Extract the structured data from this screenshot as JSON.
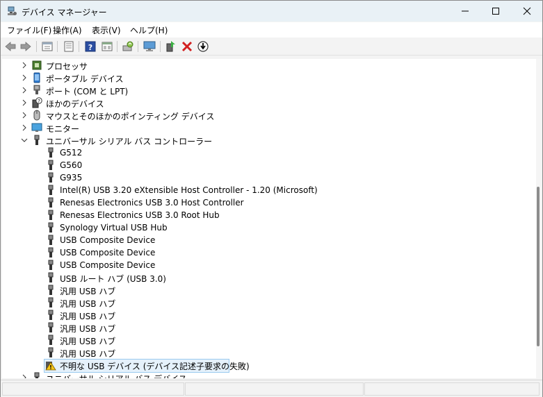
{
  "window": {
    "title": "デバイス マネージャー"
  },
  "menu": [
    "ファイル(F)",
    "操作(A)",
    "表示(V)",
    "ヘルプ(H)"
  ],
  "toolbar": {
    "buttons": [
      "back-icon",
      "forward-icon",
      "properties-view-icon",
      "list-view-icon",
      "help-icon",
      "grid-view-icon",
      "update-driver-icon",
      "monitor-scan-icon",
      "enable-device-icon",
      "uninstall-icon",
      "download-icon"
    ]
  },
  "tree": {
    "categories_top": [
      {
        "label": "プロセッサ",
        "icon": "processor-icon"
      },
      {
        "label": "ポータブル デバイス",
        "icon": "portable-device-icon"
      },
      {
        "label": "ポート (COM と LPT)",
        "icon": "port-icon"
      },
      {
        "label": "ほかのデバイス",
        "icon": "other-device-icon"
      },
      {
        "label": "マウスとそのほかのポインティング デバイス",
        "icon": "mouse-icon"
      },
      {
        "label": "モニター",
        "icon": "monitor-icon"
      }
    ],
    "usb_category": {
      "label": "ユニバーサル シリアル バス コントローラー",
      "icon": "usb-icon",
      "expanded": true
    },
    "usb_devices": [
      "G512",
      "G560",
      "G935",
      "Intel(R) USB 3.20 eXtensible Host Controller - 1.20 (Microsoft)",
      "Renesas Electronics USB 3.0 Host Controller",
      "Renesas Electronics USB 3.0 Root Hub",
      "Synology Virtual USB Hub",
      "USB Composite Device",
      "USB Composite Device",
      "USB Composite Device",
      "USB ルート ハブ (USB 3.0)",
      "汎用 USB ハブ",
      "汎用 USB ハブ",
      "汎用 USB ハブ",
      "汎用 USB ハブ",
      "汎用 USB ハブ",
      "汎用 USB ハブ"
    ],
    "selected_device": {
      "label": "不明な USB デバイス (デバイス記述子要求の失敗)",
      "icon": "warning-icon"
    },
    "next_category": {
      "label": "ユニバーサル シリアル バス デバイス",
      "icon": "usb-icon"
    }
  },
  "colors": {
    "title_bg": "#e9f1f6",
    "selection_bg": "#e5f1fb",
    "selection_border": "#99c9ef",
    "red_x": "#d21f1f",
    "help_blue": "#2b4ea2"
  }
}
